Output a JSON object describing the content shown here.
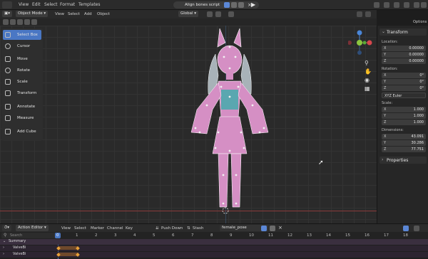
{
  "topbar": {
    "menu": [
      "View",
      "Edit",
      "Select",
      "Format",
      "Templates"
    ],
    "title": "Align bones script"
  },
  "viewport_header": {
    "mode": "Object Mode",
    "menu": [
      "View",
      "Select",
      "Add",
      "Object"
    ],
    "orientation": "Global"
  },
  "tools": [
    {
      "label": "Select Box",
      "icon": "select-box-icon",
      "active": true
    },
    {
      "label": "Cursor",
      "icon": "cursor-icon"
    },
    {
      "label": "Move",
      "icon": "move-icon"
    },
    {
      "label": "Rotate",
      "icon": "rotate-icon"
    },
    {
      "label": "Scale",
      "icon": "scale-icon"
    },
    {
      "label": "Transform",
      "icon": "transform-icon"
    },
    {
      "label": "Annotate",
      "icon": "annotate-icon"
    },
    {
      "label": "Measure",
      "icon": "measure-icon"
    },
    {
      "label": "Add Cube",
      "icon": "add-cube-icon"
    }
  ],
  "npanel": {
    "options_tab": "Options",
    "transform_title": "Transform",
    "location_label": "Location:",
    "location": [
      {
        "axis": "X",
        "value": "0.00000"
      },
      {
        "axis": "Y",
        "value": "0.00000"
      },
      {
        "axis": "Z",
        "value": "0.00000"
      }
    ],
    "rotation_label": "Rotation:",
    "rotation": [
      {
        "axis": "X",
        "value": "0°"
      },
      {
        "axis": "Y",
        "value": "0°"
      },
      {
        "axis": "Z",
        "value": "0°"
      }
    ],
    "rotation_mode": "XYZ Euler",
    "scale_label": "Scale:",
    "scale": [
      {
        "axis": "X",
        "value": "1.000"
      },
      {
        "axis": "Y",
        "value": "1.000"
      },
      {
        "axis": "Z",
        "value": "1.000"
      }
    ],
    "dimensions_label": "Dimensions:",
    "dimensions": [
      {
        "axis": "X",
        "value": "43.091"
      },
      {
        "axis": "Y",
        "value": "30.286"
      },
      {
        "axis": "Z",
        "value": "77.751"
      }
    ],
    "properties_title": "Properties"
  },
  "action_editor": {
    "editor_type": "Action Editor",
    "menu": [
      "View",
      "Select",
      "Marker",
      "Channel",
      "Key"
    ],
    "push_down": "Push Down",
    "stash": "Stash",
    "action_name": "female_pose",
    "search_placeholder": "Search",
    "summary": "Summary",
    "channels": [
      "ValveBi",
      "ValveBi"
    ],
    "frame_numbers": [
      "0",
      "1",
      "2",
      "3",
      "4",
      "5",
      "6",
      "7",
      "8",
      "9",
      "10",
      "11",
      "12",
      "13",
      "14",
      "15",
      "16",
      "17",
      "18"
    ]
  },
  "colors": {
    "accent": "#4a77c4",
    "mesh": "#d58fc4",
    "body_accent": "#5aa7b0",
    "keyframe": "#e8a13a"
  }
}
